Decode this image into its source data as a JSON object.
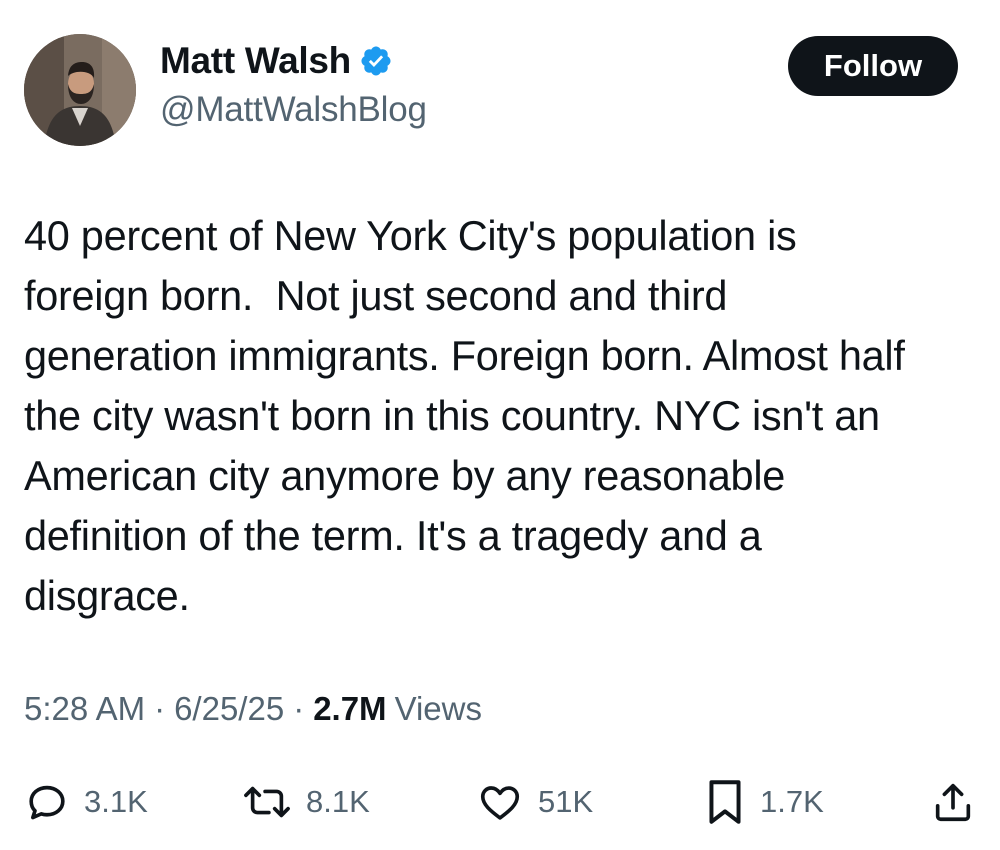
{
  "author": {
    "name": "Matt Walsh",
    "handle": "@MattWalshBlog",
    "verified": true,
    "verified_color": "#1d9bf0"
  },
  "follow_label": "Follow",
  "tweet": {
    "text": "40 percent of New York City's population is\nforeign born.  Not just second and third\ngeneration immigrants. Foreign born. Almost half\nthe city wasn't born in this country. NYC isn't an\nAmerican city anymore by any reasonable\ndefinition of the term. It's a tragedy and a\ndisgrace."
  },
  "meta": {
    "time": "5:28 AM",
    "separator": "·",
    "date": "6/25/25",
    "views_count": "2.7M",
    "views_label": "Views"
  },
  "actions": {
    "replies": {
      "icon": "reply-icon",
      "count": "3.1K"
    },
    "reposts": {
      "icon": "repost-icon",
      "count": "8.1K"
    },
    "likes": {
      "icon": "heart-icon",
      "count": "51K"
    },
    "bookmarks": {
      "icon": "bookmark-icon",
      "count": "1.7K"
    },
    "share": {
      "icon": "share-icon"
    }
  },
  "colors": {
    "text": "#0f1419",
    "secondary": "#536471",
    "button": "#0f1419"
  }
}
